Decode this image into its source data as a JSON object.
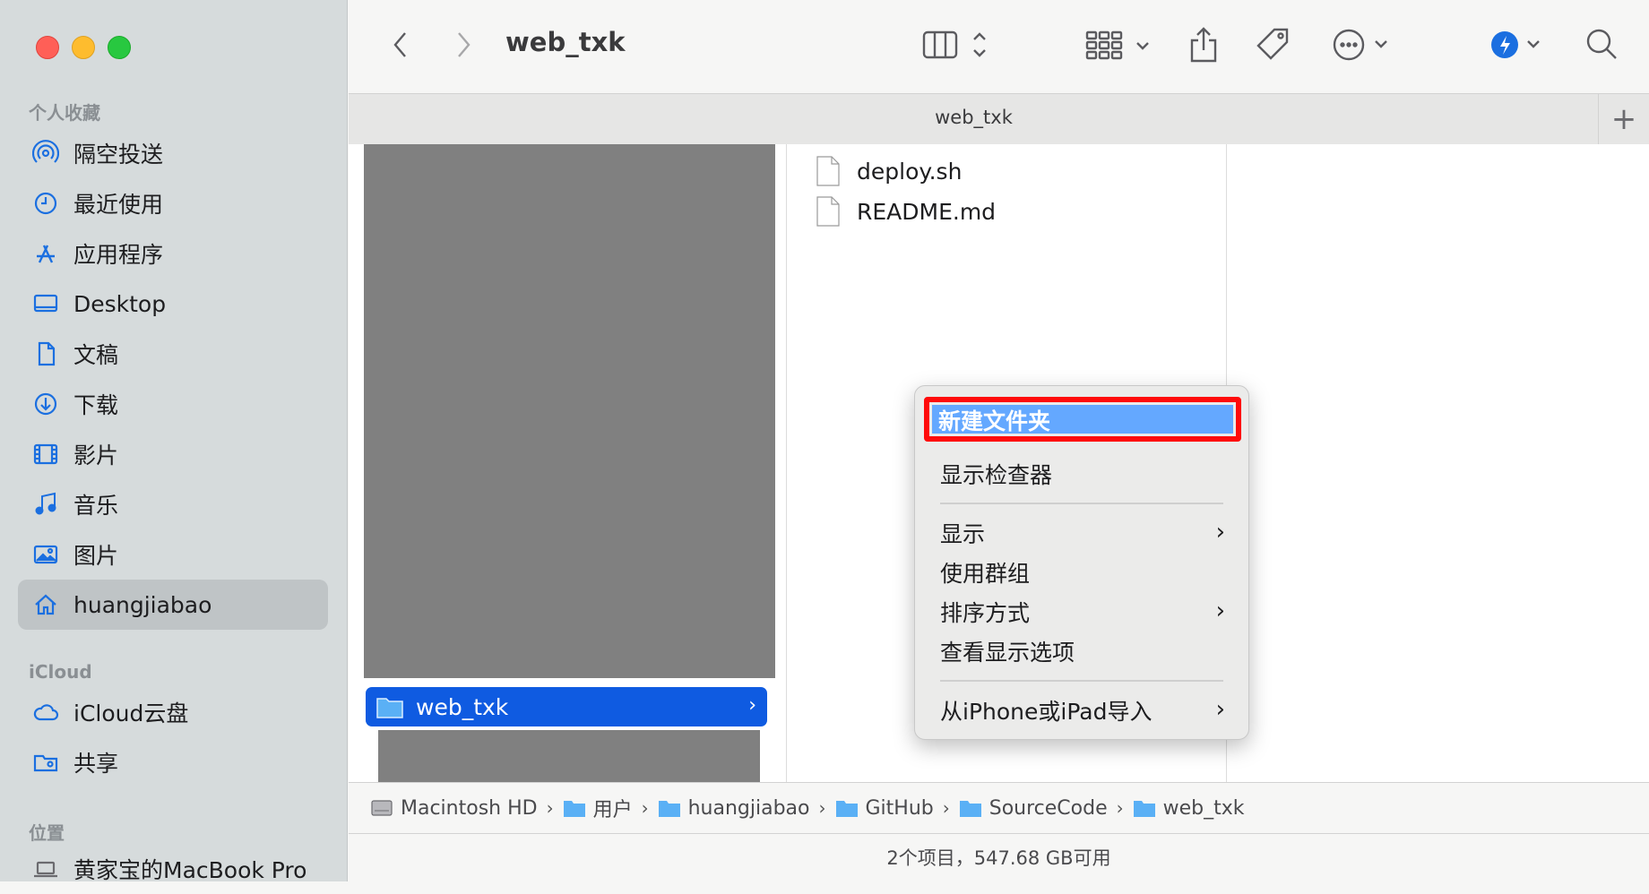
{
  "window": {
    "title": "web_txk",
    "tab": "web_txk"
  },
  "sidebar": {
    "section_favorites": "个人收藏",
    "favorites": [
      {
        "label": "隔空投送",
        "icon": "airdrop-icon"
      },
      {
        "label": "最近使用",
        "icon": "clock-icon"
      },
      {
        "label": "应用程序",
        "icon": "apps-icon"
      },
      {
        "label": "Desktop",
        "icon": "desktop-icon"
      },
      {
        "label": "文稿",
        "icon": "document-icon"
      },
      {
        "label": "下载",
        "icon": "download-icon"
      },
      {
        "label": "影片",
        "icon": "film-icon"
      },
      {
        "label": "音乐",
        "icon": "music-icon"
      },
      {
        "label": "图片",
        "icon": "photo-icon"
      },
      {
        "label": "huangjiabao",
        "icon": "home-icon",
        "active": true
      }
    ],
    "section_icloud": "iCloud",
    "icloud": [
      {
        "label": "iCloud云盘",
        "icon": "cloud-icon"
      },
      {
        "label": "共享",
        "icon": "shared-folder-icon"
      }
    ],
    "section_locations": "位置",
    "locations": [
      {
        "label": "黄家宝的MacBook Pro",
        "icon": "laptop-icon"
      }
    ]
  },
  "browser": {
    "selected_folder": "web_txk",
    "files": [
      "deploy.sh",
      "README.md"
    ]
  },
  "context_menu": {
    "highlighted": "新建文件夹",
    "items": [
      "显示检查器",
      "显示",
      "使用群组",
      "排序方式",
      "查看显示选项",
      "从iPhone或iPad导入"
    ]
  },
  "pathbar": [
    "Macintosh HD",
    "用户",
    "huangjiabao",
    "GitHub",
    "SourceCode",
    "web_txk"
  ],
  "status": "2个项目，547.68 GB可用",
  "colors": {
    "selection": "#0f5be1",
    "highlight_border": "#ff0a0a",
    "menu_highlight": "#64a8ff"
  }
}
